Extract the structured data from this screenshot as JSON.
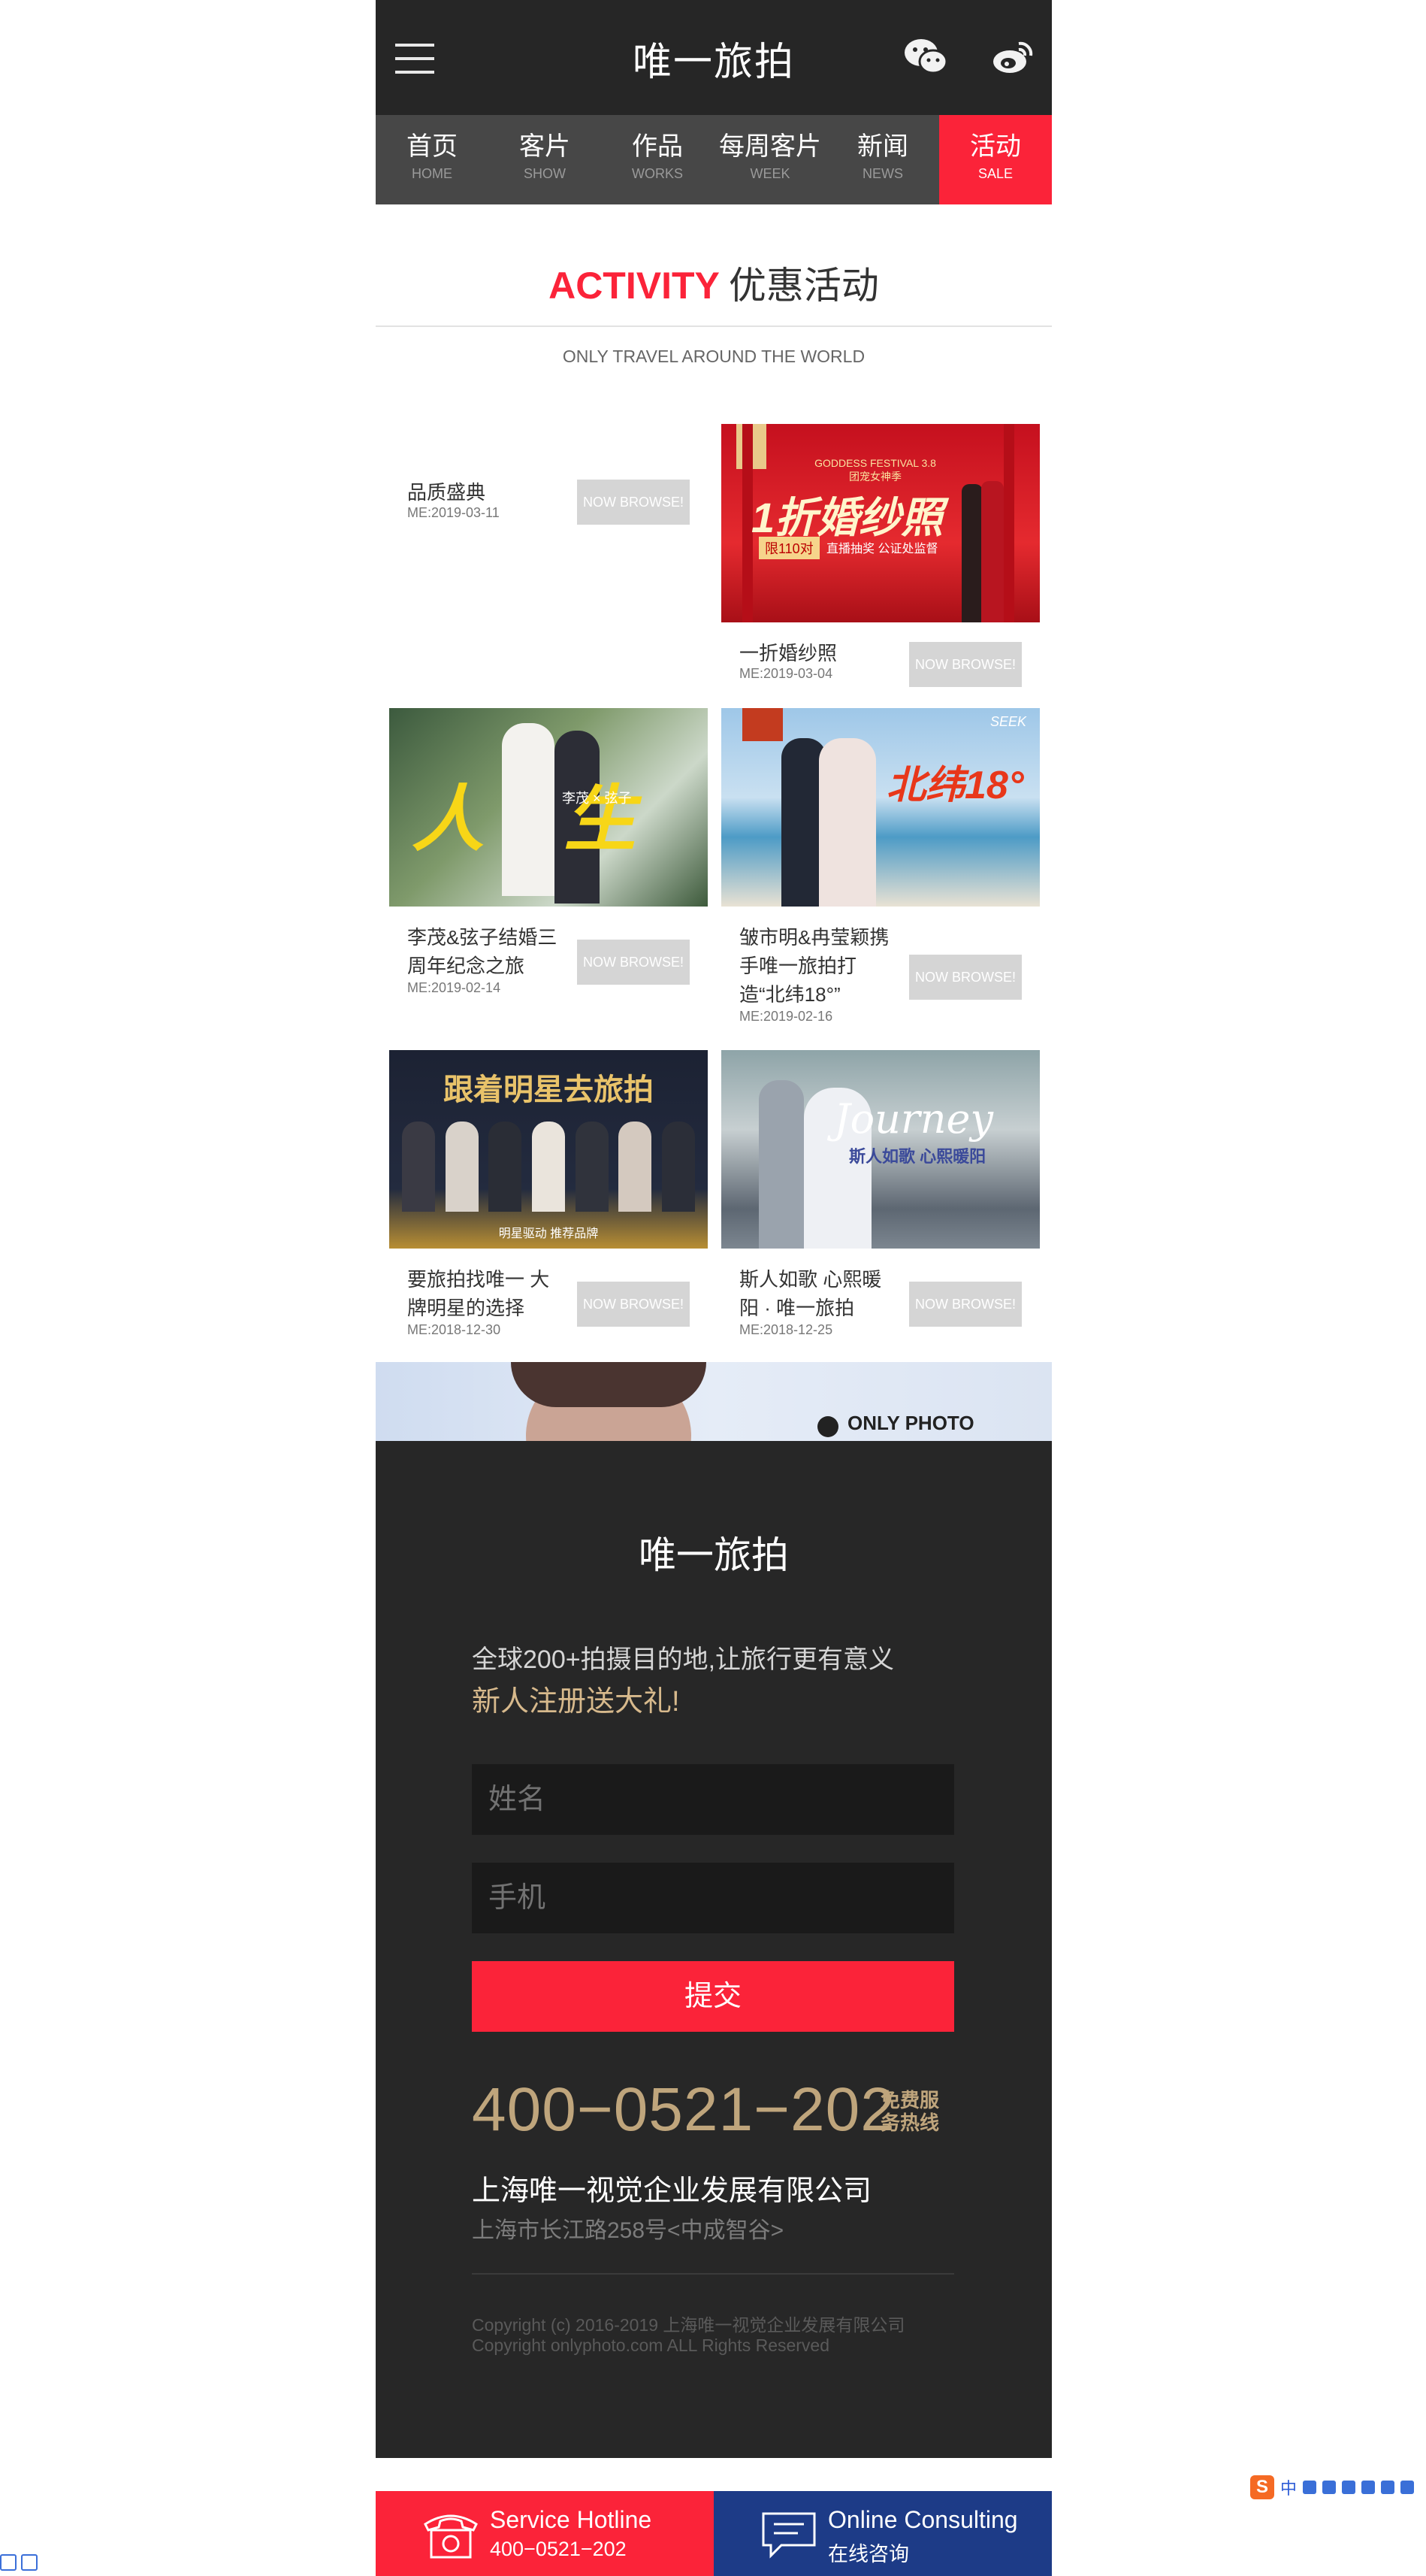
{
  "header": {
    "title": "唯一旅拍"
  },
  "nav": [
    {
      "zh": "首页",
      "en": "HOME",
      "active": false
    },
    {
      "zh": "客片",
      "en": "SHOW",
      "active": false
    },
    {
      "zh": "作品",
      "en": "WORKS",
      "active": false
    },
    {
      "zh": "每周客片",
      "en": "WEEK",
      "active": false
    },
    {
      "zh": "新闻",
      "en": "NEWS",
      "active": false
    },
    {
      "zh": "活动",
      "en": "SALE",
      "active": true
    }
  ],
  "section": {
    "title_en": "ACTIVITY",
    "title_zh": "优惠活动",
    "subtitle": "ONLY TRAVEL AROUND THE WORLD"
  },
  "activities": [
    {
      "title": "品质盛典",
      "date": "ME:2019-03-11",
      "button": "NOW BROWSE!"
    },
    {
      "title": "一折婚纱照",
      "date": "ME:2019-03-04",
      "button": "NOW BROWSE!",
      "img_text": "1折婚纱照",
      "img_badge": "限110对",
      "img_sub": "直播抽奖 公证处监督",
      "img_top": "GODDESS FESTIVAL 3.8团宠女神季"
    },
    {
      "title": "李茂&弦子结婚三周年纪念之旅",
      "date": "ME:2019-02-14",
      "button": "NOW BROWSE!",
      "img_text": "人 生",
      "img_sub": "李茂 × 弦子"
    },
    {
      "title": "皱市明&冉莹颖携手唯一旅拍打造“北纬18°”",
      "date": "ME:2019-02-16",
      "button": "NOW BROWSE!",
      "img_text": "北纬18°",
      "img_corner": "SEEK"
    },
    {
      "title": "要旅拍找唯一 大牌明星的选择",
      "date": "ME:2018-12-30",
      "button": "NOW BROWSE!",
      "img_text": "跟着明星去旅拍",
      "img_sub": "明星驱动  推荐品牌"
    },
    {
      "title": "斯人如歌 心熙暖阳 · 唯一旅拍",
      "date": "ME:2018-12-25",
      "button": "NOW BROWSE!",
      "img_text": "Journey",
      "img_sub": "斯人如歌 心熙暖阳"
    }
  ],
  "banner": {
    "logo": "ONLY PHOTO"
  },
  "footer": {
    "brand": "唯一旅拍",
    "slogan": "全球200+拍摄目的地,让旅行更有意义",
    "gift": "新人注册送大礼!",
    "name_placeholder": "姓名",
    "phone_placeholder": "手机",
    "submit": "提交",
    "hotline": "400−0521−202",
    "hotline_tag": "免费服务热线",
    "company": "上海唯一视觉企业发展有限公司",
    "address": "上海市长江路258号<中成智谷>",
    "copyright1": "Copyright (c) 2016-2019 上海唯一视觉企业发展有限公司",
    "copyright2": "Copyright onlyphoto.com ALL Rights Reserved"
  },
  "bottom_bar": {
    "hotline_label": "Service Hotline",
    "hotline_number": "400−0521−202",
    "consult_label": "Online Consulting",
    "consult_zh": "在线咨询"
  },
  "ime": {
    "logo": "S",
    "lang": "中"
  },
  "colors": {
    "accent": "#fb2339",
    "dark": "#262626",
    "gold": "#bfa57c",
    "blue": "#1d3b87"
  }
}
